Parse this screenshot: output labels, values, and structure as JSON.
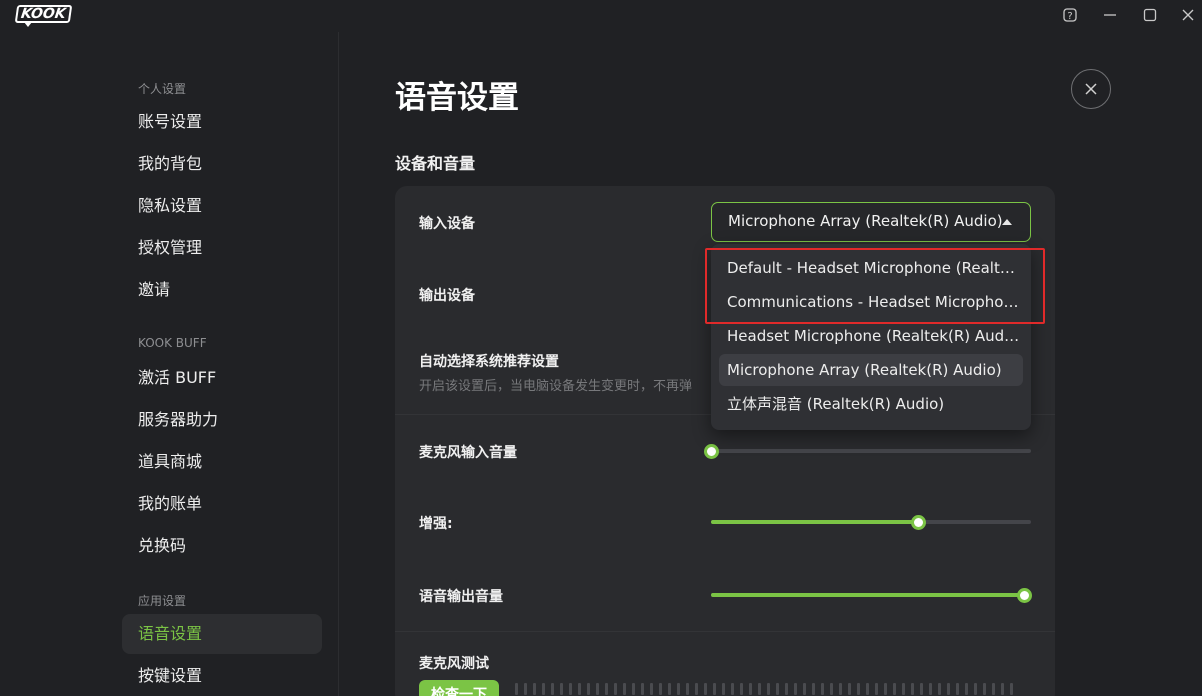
{
  "app": {
    "logo_text": "KOOK"
  },
  "window": {
    "help_icon": "help-icon",
    "minimize_icon": "minimize-icon",
    "maximize_icon": "maximize-icon",
    "close_icon": "close-icon"
  },
  "sidebar": {
    "sections": [
      {
        "title": "个人设置",
        "items": [
          "账号设置",
          "我的背包",
          "隐私设置",
          "授权管理",
          "邀请"
        ]
      },
      {
        "title": "KOOK BUFF",
        "items": [
          "激活 BUFF",
          "服务器助力",
          "道具商城",
          "我的账单",
          "兑换码"
        ]
      },
      {
        "title": "应用设置",
        "items": [
          "语音设置",
          "按键设置"
        ]
      }
    ],
    "active_item": "语音设置"
  },
  "main": {
    "title": "语音设置",
    "section_title": "设备和音量",
    "input_device": {
      "label": "输入设备",
      "value": "Microphone Array (Realtek(R) Audio)"
    },
    "output_device": {
      "label": "输出设备"
    },
    "auto_select": {
      "label": "自动选择系统推荐设置",
      "desc": "开启该设置后，当电脑设备发生变更时，不再弹"
    },
    "mic_volume": {
      "label": "麦克风输入音量",
      "level": 0
    },
    "boost": {
      "label": "增强:",
      "level": 0.66
    },
    "output_volume": {
      "label": "语音输出音量",
      "level": 1.0
    },
    "mic_test": {
      "label": "麦克风测试",
      "button": "检查一下"
    }
  },
  "dropdown": {
    "options": [
      "Default - Headset Microphone (Realtek(R...",
      "Communications - Headset Microphone ...",
      "Headset Microphone (Realtek(R) Audio)",
      "Microphone Array (Realtek(R) Audio)",
      "立体声混音 (Realtek(R) Audio)"
    ],
    "selected_index": 3
  },
  "colors": {
    "accent": "#7bc445",
    "highlight": "#e02a2a",
    "background": "#202124",
    "card": "#2a2b2e"
  }
}
